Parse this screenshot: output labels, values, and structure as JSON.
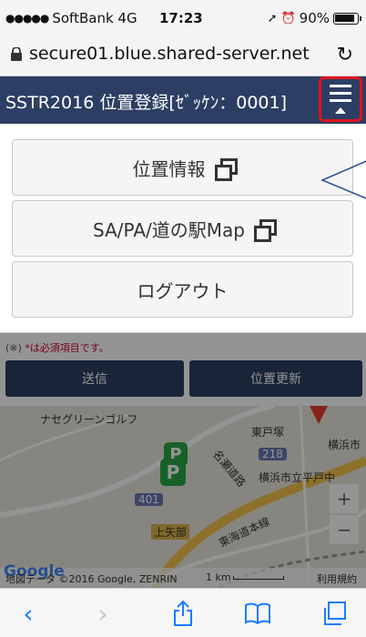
{
  "status_bar": {
    "carrier": "SoftBank",
    "network": "4G",
    "time": "17:23",
    "battery_text": "90%",
    "battery_level": 0.9
  },
  "url_bar": {
    "url": "secure01.blue.shared-server.net",
    "icons": [
      "lock-icon",
      "reload-icon"
    ]
  },
  "header": {
    "title": "SSTR2016 位置登録[ｾﾞｯｹﾝ：0001]",
    "menu_icon": "hamburger-icon",
    "highlight_color": "#e0141e",
    "bg_color": "#2c3e63"
  },
  "menu": {
    "items": [
      {
        "label": "位置情報",
        "external": true
      },
      {
        "label": "SA/PA/道の駅Map",
        "external": true
      },
      {
        "label": "ログアウト",
        "external": false
      }
    ]
  },
  "form": {
    "note_mark": "(※)",
    "note_text": "*は必須項目です。",
    "send_label": "送信",
    "update_label": "位置更新"
  },
  "map": {
    "labels": {
      "golf": "ナセグリーンゴルフ",
      "higashitotsuka": "東戸塚",
      "yokohama": "横浜市",
      "route218": "218",
      "school": "横浜市立平戸中",
      "route401": "401",
      "nagoya_road": "名瀬道路",
      "kamiyabe": "上矢部",
      "tokaido": "東海道本線",
      "p_mark": "P"
    },
    "google": "Google",
    "attribution": "地図データ ©2016 Google, ZENRIN",
    "scale": "1 km",
    "terms": "利用規約",
    "zoom_in": "+",
    "zoom_out": "−"
  },
  "toolbar": {
    "icons": [
      "back-icon",
      "forward-icon",
      "share-icon",
      "bookmarks-icon",
      "tabs-icon"
    ]
  }
}
